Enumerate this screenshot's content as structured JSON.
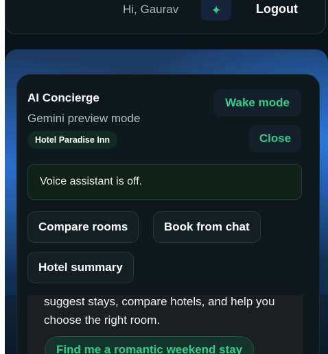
{
  "topbar": {
    "greeting": "Hi, Gaurav",
    "star_glyph": "✦",
    "logout_label": "Logout"
  },
  "concierge": {
    "title": "AI Concierge",
    "subtitle": "Gemini preview mode",
    "hotel_name": "Hotel Paradise Inn",
    "wake_label": "Wake mode",
    "close_label": "Close",
    "status": "Voice assistant is off.",
    "actions": [
      "Compare rooms",
      "Book from chat",
      "Hotel summary"
    ]
  },
  "chat": {
    "message": "suggest stays, compare hotels, and help you choose the right room.",
    "suggestion": "Find me a romantic weekend stay"
  },
  "colors": {
    "accent": "#2bd18a",
    "panel": "#0f181c",
    "hero_blue": "#2a6fd0"
  }
}
